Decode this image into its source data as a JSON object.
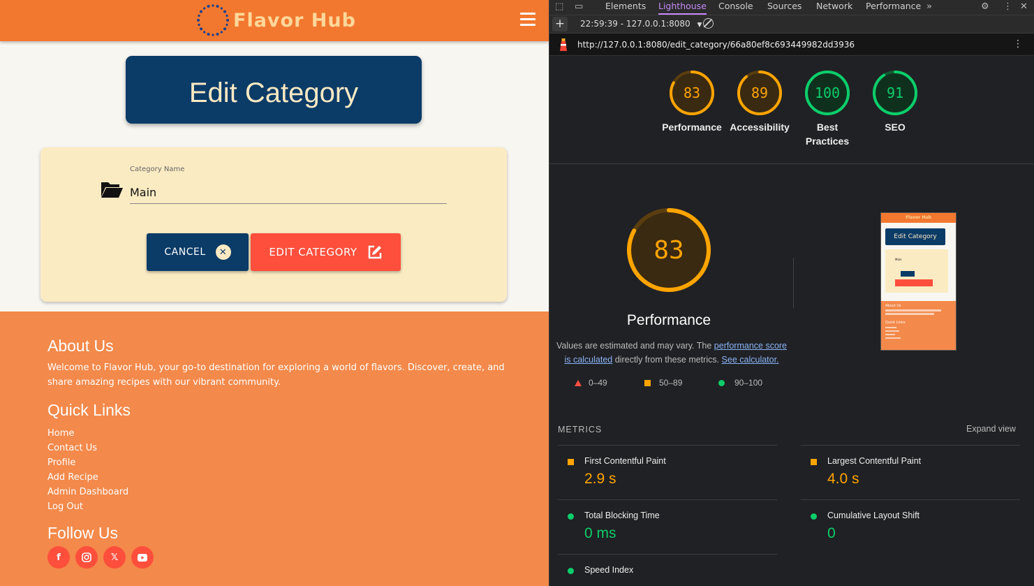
{
  "site": {
    "brand": "Flavor Hub",
    "page_title": "Edit Category",
    "form": {
      "field_label": "Category Name",
      "field_value": "Main",
      "cancel_label": "CANCEL",
      "submit_label": "EDIT CATEGORY"
    },
    "footer": {
      "about_heading": "About Us",
      "about_text": "Welcome to Flavor Hub, your go-to destination for exploring a world of flavors. Discover, create, and share amazing recipes with our vibrant community.",
      "links_heading": "Quick Links",
      "links": [
        "Home",
        "Contact Us",
        "Profile",
        "Add Recipe",
        "Admin Dashboard",
        "Log Out"
      ],
      "follow_heading": "Follow Us",
      "socials": [
        "facebook-icon",
        "instagram-icon",
        "x-icon",
        "youtube-icon"
      ]
    },
    "colors": {
      "navbar": "#f2782f",
      "primary": "#0b3b67",
      "accent": "#fd4f3c",
      "cream": "#fbebc3",
      "footer": "#f3894a"
    }
  },
  "devtools": {
    "tabs": [
      "Elements",
      "Lighthouse",
      "Console",
      "Sources",
      "Network",
      "Performance"
    ],
    "active_tab": "Lighthouse",
    "run_label": "22:59:39 - 127.0.0.1:8080",
    "url": "http://127.0.0.1:8080/edit_category/66a80ef8c693449982dd3936",
    "scores": [
      {
        "label": "Performance",
        "value": "83",
        "color": "#ffa400",
        "fraction": 0.83
      },
      {
        "label": "Accessibility",
        "value": "89",
        "color": "#ffa400",
        "fraction": 0.89
      },
      {
        "label": "Best Practices",
        "value": "100",
        "color": "#0cce6b",
        "fraction": 1.0
      },
      {
        "label": "SEO",
        "value": "91",
        "color": "#0cce6b",
        "fraction": 0.91
      }
    ],
    "main_score": {
      "value": "83",
      "label": "Performance",
      "fraction": 0.83
    },
    "desc_prefix": "Values are estimated and may vary. The ",
    "desc_link": "performance score is calculated",
    "desc_mid": " directly from these metrics. ",
    "desc_calc": "See calculator.",
    "legend": [
      "0–49",
      "50–89",
      "90–100"
    ],
    "metrics_heading": "METRICS",
    "expand_label": "Expand view",
    "metrics": [
      {
        "name": "First Contentful Paint",
        "value": "2.9 s",
        "status": "average"
      },
      {
        "name": "Largest Contentful Paint",
        "value": "4.0 s",
        "status": "average"
      },
      {
        "name": "Total Blocking Time",
        "value": "0 ms",
        "status": "pass"
      },
      {
        "name": "Cumulative Layout Shift",
        "value": "0",
        "status": "pass"
      },
      {
        "name": "Speed Index",
        "value": "",
        "status": "pass"
      }
    ],
    "thumb": {
      "brand": "Flavor Hub",
      "title": "Edit Category",
      "value": "Main",
      "about": "About Us",
      "quick": "Quick Links"
    }
  }
}
